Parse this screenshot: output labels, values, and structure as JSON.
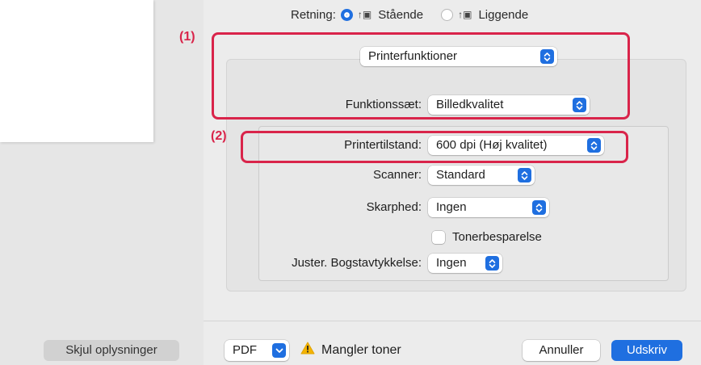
{
  "orientation": {
    "label": "Retning:",
    "portrait": "Stående",
    "landscape": "Liggende",
    "selected": "portrait"
  },
  "callouts": {
    "one": "(1)",
    "two": "(2)"
  },
  "section_popup": {
    "value": "Printerfunktioner"
  },
  "feature_set": {
    "label": "Funktionssæt:",
    "value": "Billedkvalitet"
  },
  "print_mode": {
    "label": "Printertilstand:",
    "value": "600 dpi (Høj kvalitet)"
  },
  "scanner": {
    "label": "Scanner:",
    "value": "Standard"
  },
  "sharpness": {
    "label": "Skarphed:",
    "value": "Ingen"
  },
  "toner_save": {
    "label": "Tonerbesparelse",
    "checked": false
  },
  "font_weight": {
    "label": "Juster. Bogstavtykkelse:",
    "value": "Ingen"
  },
  "footer": {
    "hide_details": "Skjul oplysninger",
    "pdf": "PDF",
    "warning": "Mangler toner",
    "cancel": "Annuller",
    "print": "Udskriv"
  },
  "colors": {
    "accent": "#1f6fe0",
    "highlight": "#d9244a",
    "warning": "#f5b400"
  }
}
